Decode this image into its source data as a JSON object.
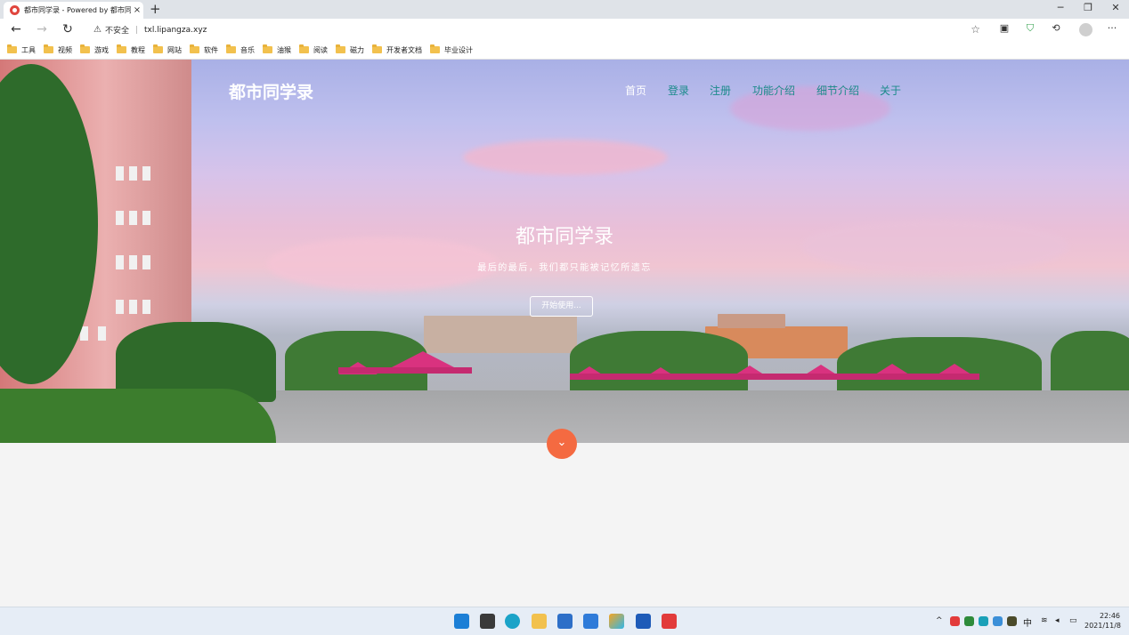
{
  "browser": {
    "tab_title": "都市同学录 - Powered by 都市同",
    "tab_close": "×",
    "new_tab": "+",
    "window_controls": {
      "minimize": "─",
      "restore": "❐",
      "close": "✕"
    },
    "nav": {
      "back": "←",
      "forward": "→",
      "reload": "↻"
    },
    "address": {
      "warning_icon": "⚠",
      "security_label": "不安全",
      "separator": "|",
      "url": "txl.lipangza.xyz",
      "star": "☆"
    },
    "toolbar_icons": [
      "collections-icon",
      "shield-extension-icon",
      "extensions-icon",
      "profile-avatar",
      "more-menu-icon"
    ],
    "more": "···",
    "bookmarks": [
      "工具",
      "视频",
      "游戏",
      "教程",
      "网站",
      "软件",
      "音乐",
      "油猴",
      "阅读",
      "磁力",
      "开发者文档",
      "毕业设计"
    ]
  },
  "site": {
    "brand": "都市同学录",
    "menu": [
      "首页",
      "登录",
      "注册",
      "功能介绍",
      "细节介绍",
      "关于"
    ],
    "hero_title": "都市同学录",
    "hero_subtitle": "最后的最后，我们都只能被记忆所遗忘",
    "hero_button": "开始使用...",
    "scroll_down": "⌄",
    "colors": {
      "accent": "#f46a41",
      "menu": "#1a8a8a"
    }
  },
  "taskbar": {
    "apps": [
      "start-icon",
      "taskview-icon",
      "edge-icon",
      "file-explorer-icon",
      "store-icon",
      "app-icon",
      "paint-icon",
      "word-icon",
      "wps-icon"
    ],
    "tray_chevron": "^",
    "ime": "中",
    "time": "22:46",
    "date": "2021/11/8"
  }
}
